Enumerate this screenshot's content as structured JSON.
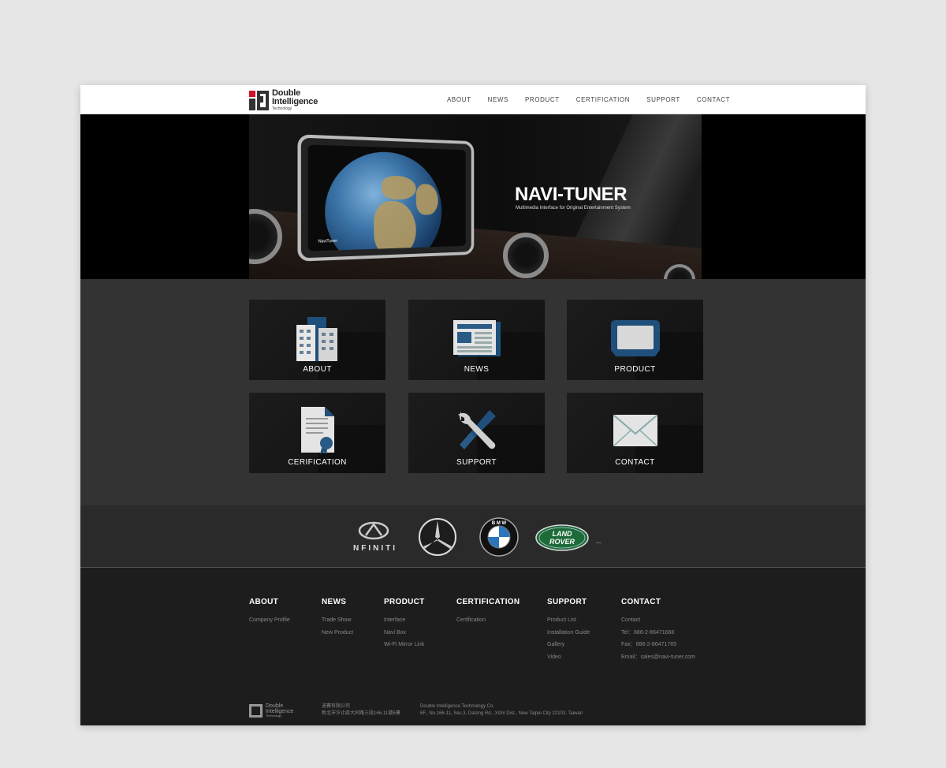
{
  "header": {
    "logo": {
      "line1": "Double",
      "line2": "Intelligence",
      "line3": "Technology"
    },
    "nav": [
      "ABOUT",
      "NEWS",
      "PRODUCT",
      "CERTIFICATION",
      "SUPPORT",
      "CONTACT"
    ]
  },
  "hero": {
    "title": "NAVI-TUNER",
    "subtitle": "Multimedia Interface for Original Entertainment System",
    "screen_label": "NaviTuner"
  },
  "tiles": [
    {
      "label": "ABOUT",
      "icon": "building-icon"
    },
    {
      "label": "NEWS",
      "icon": "newspaper-icon"
    },
    {
      "label": "PRODUCT",
      "icon": "monitor-icon"
    },
    {
      "label": "CERIFICATION",
      "icon": "certificate-icon"
    },
    {
      "label": "SUPPORT",
      "icon": "tools-icon"
    },
    {
      "label": "CONTACT",
      "icon": "envelope-icon"
    }
  ],
  "brands": {
    "infiniti": "NFINITI",
    "bmw": "B M W",
    "landrover_1": "LAND",
    "landrover_2": "ROVER",
    "trailing_mark": "—"
  },
  "footer": {
    "columns": [
      {
        "title": "ABOUT",
        "links": [
          "Company Profile"
        ]
      },
      {
        "title": "NEWS",
        "links": [
          "Trade Show",
          "New Product"
        ]
      },
      {
        "title": "PRODUCT",
        "links": [
          "Interface",
          "Navi Box",
          "Wi-Fi Mirror Link"
        ]
      },
      {
        "title": "CERTIFICATION",
        "links": [
          "Certification"
        ]
      },
      {
        "title": "SUPPORT",
        "links": [
          "Product List",
          "Installation Guide",
          "Gallery",
          "Video"
        ]
      },
      {
        "title": "CONTACT",
        "links": [
          "Contact",
          "Tel：886-2-86471668",
          "Fax：886-2-86471765",
          "Email：sales@navi-tuner.com"
        ]
      }
    ],
    "logo": {
      "line1": "Double",
      "line2": "Intelligence",
      "line3": "Technology"
    },
    "cn_line1": "迪賽有限公司",
    "cn_line2": "新北市汐止區大同路三段166-11號6樓",
    "en_line1": "Double Intelligence Technology Co.",
    "en_line2": "6F., No.166-11, Sec.3, Datong Rd., Xizhi Dist., New Taipei City 22103, Taiwan"
  },
  "colors": {
    "accent_blue": "#1f4f7a",
    "tile_bg": "#161616",
    "section_bg": "#333333"
  }
}
